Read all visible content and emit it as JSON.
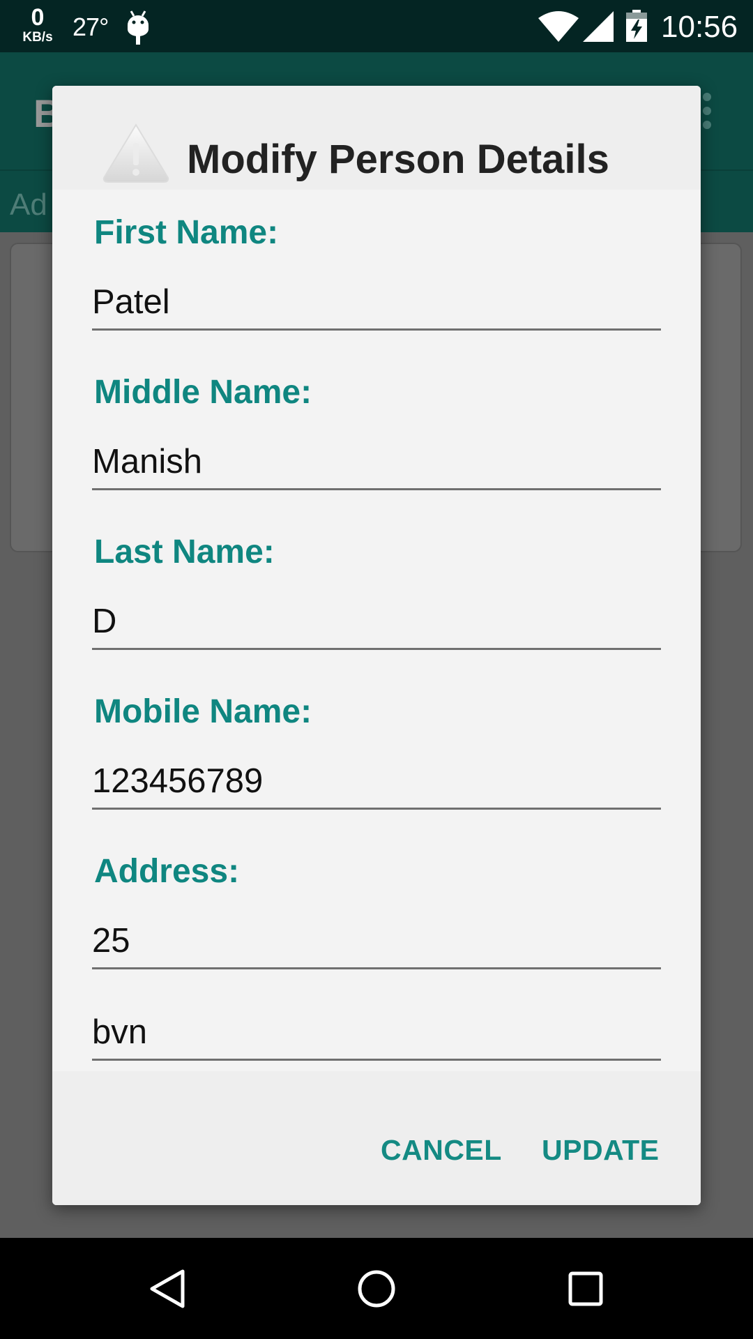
{
  "status_bar": {
    "speed_value": "0",
    "speed_unit": "KB/s",
    "temperature": "27°",
    "time": "10:56",
    "icons": [
      "android-icon",
      "wifi-icon",
      "signal-icon",
      "battery-charging-icon"
    ]
  },
  "background_app": {
    "title": "B",
    "tab_label": "Ad"
  },
  "dialog": {
    "title": "Modify Person Details",
    "header_icon": "warning-icon",
    "fields": [
      {
        "label": "First Name:",
        "value": "Patel"
      },
      {
        "label": "Middle Name:",
        "value": "Manish"
      },
      {
        "label": "Last Name:",
        "value": "D"
      },
      {
        "label": "Mobile Name:",
        "value": "123456789"
      },
      {
        "label": "Address:",
        "value": "25"
      },
      {
        "label": "",
        "value": "bvn"
      }
    ],
    "buttons": {
      "cancel": "CANCEL",
      "update": "UPDATE"
    },
    "accent_color": "#0f8680"
  },
  "nav_bar": {
    "icons": [
      "back-icon",
      "home-icon",
      "recents-icon"
    ]
  }
}
